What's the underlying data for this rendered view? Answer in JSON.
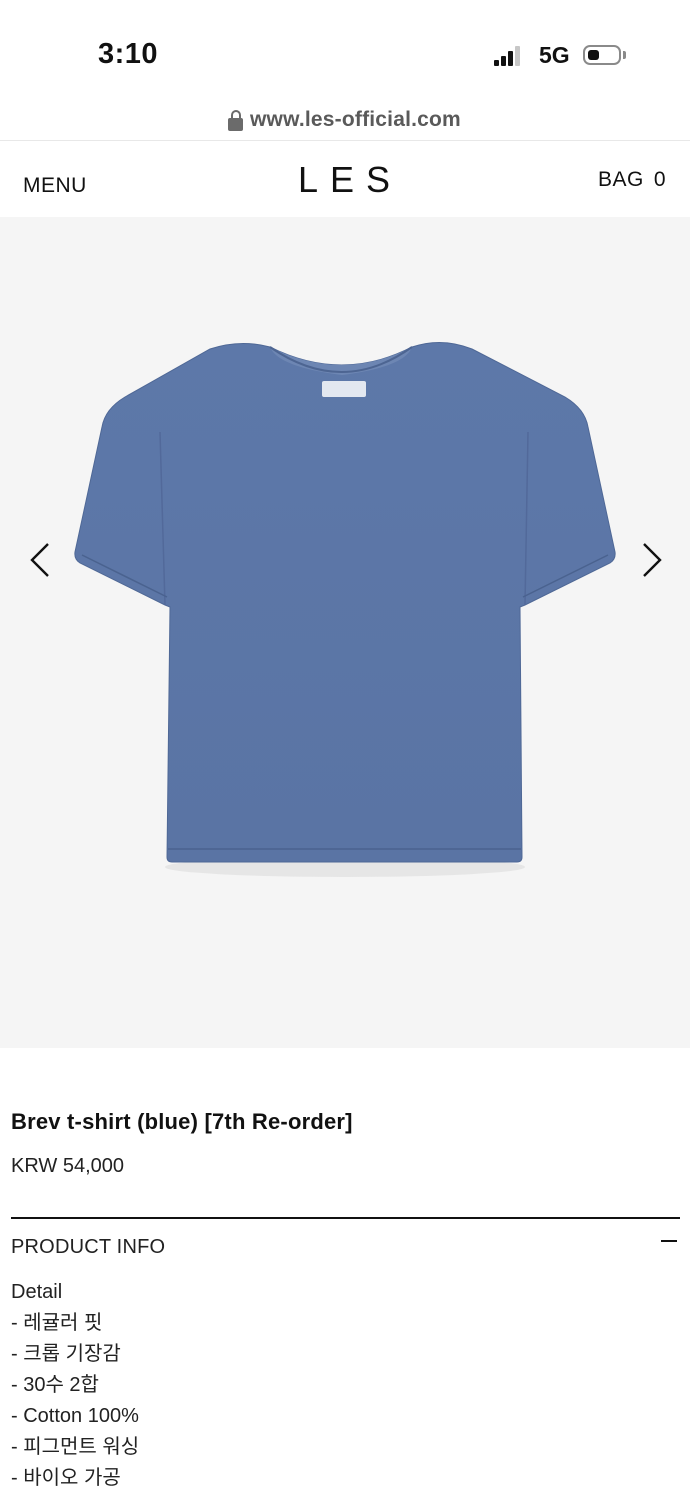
{
  "status_bar": {
    "time": "3:10",
    "network": "5G"
  },
  "browser": {
    "url": "www.les-official.com"
  },
  "header": {
    "menu_label": "MENU",
    "logo": "LES",
    "bag_label": "BAG",
    "bag_count": "0"
  },
  "gallery": {
    "image_icon": "blue-tshirt-image",
    "shirt_color": "#5c77a8",
    "background_color": "#f5f5f5"
  },
  "product": {
    "name": "Brev t-shirt (blue) [7th Re-order]",
    "price": "KRW 54,000",
    "info_header": "PRODUCT INFO",
    "detail_lines": [
      "Detail",
      "- 레귤러 핏",
      "- 크롭 기장감",
      "- 30수 2합",
      "- Cotton 100%",
      "- 피그먼트 워싱",
      "- 바이오 가공"
    ]
  }
}
